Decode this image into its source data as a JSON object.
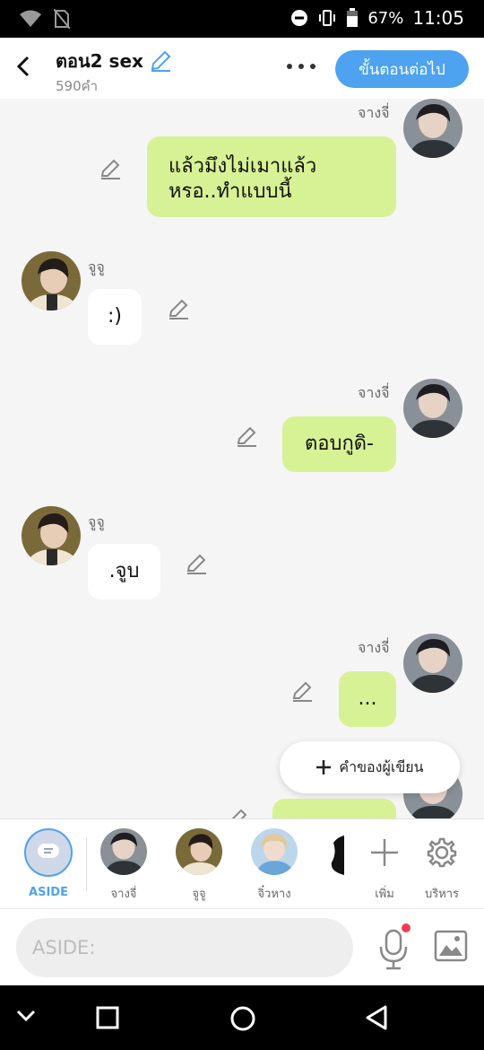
{
  "status_bar": {
    "battery": "67%",
    "time": "11:05",
    "icons": [
      "wifi-icon",
      "no-sim-icon",
      "do-not-disturb-icon",
      "vibrate-icon",
      "battery-icon"
    ]
  },
  "header": {
    "title": "ตอน2 sex",
    "word_count": "590คำ",
    "next_button": "ขั้นตอนต่อไป"
  },
  "messages": [
    {
      "side": "right",
      "sender": "จางจี่",
      "text_lines": [
        "แล้วมึงไม่เมาแล้ว",
        "หรอ..ทำแบบนี้"
      ]
    },
    {
      "side": "left",
      "sender": "จูจู",
      "text_lines": [
        ":)"
      ]
    },
    {
      "side": "right",
      "sender": "จางจี่",
      "text_lines": [
        "ตอบกูดิ-"
      ]
    },
    {
      "side": "left",
      "sender": "จูจู",
      "text_lines": [
        ".จูบ"
      ]
    },
    {
      "side": "right",
      "sender": "จางจี่",
      "text_lines": [
        "..."
      ]
    }
  ],
  "fab": {
    "label": "คำของผู้เขียน"
  },
  "character_bar": {
    "aside": "ASIDE",
    "characters": [
      "จางจี่",
      "จูจู",
      "จิ๋วหาง"
    ],
    "add_label": "เพิ่ม",
    "manage_label": "บริหาร"
  },
  "input": {
    "placeholder": "ASIDE:"
  },
  "colors": {
    "accent": "#4da3f0",
    "bubble_right": "#d7f294",
    "bubble_left": "#ffffff",
    "background": "#f5f5f5"
  }
}
